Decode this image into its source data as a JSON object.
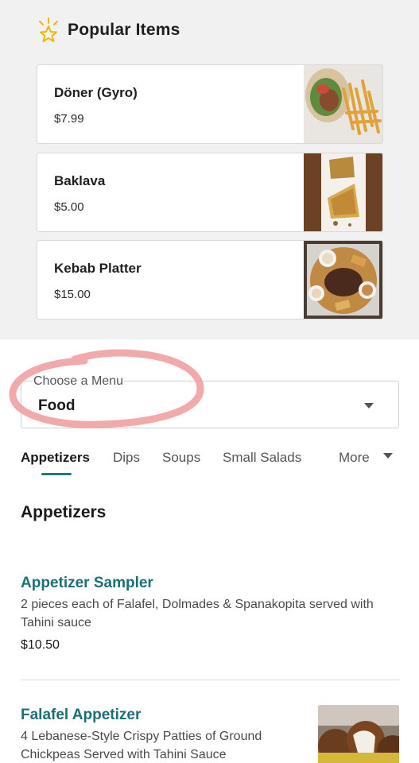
{
  "popular": {
    "title": "Popular Items",
    "items": [
      {
        "name": "Döner (Gyro)",
        "price": "$7.99"
      },
      {
        "name": "Baklava",
        "price": "$5.00"
      },
      {
        "name": "Kebab Platter",
        "price": "$15.00"
      }
    ]
  },
  "menu_select": {
    "label": "Choose a Menu",
    "value": "Food"
  },
  "tabs": {
    "items": [
      "Appetizers",
      "Dips",
      "Soups",
      "Small Salads"
    ],
    "active": "Appetizers",
    "more_label": "More"
  },
  "section": {
    "title": "Appetizers",
    "items": [
      {
        "name": "Appetizer Sampler",
        "description": "2 pieces each of Falafel, Dolmades & Spanakopita served with Tahini sauce",
        "price": "$10.50"
      },
      {
        "name": "Falafel Appetizer",
        "description": "4 Lebanese-Style Crispy Patties of Ground Chickpeas Served with Tahini Sauce"
      }
    ]
  },
  "colors": {
    "accent": "#1c7a83",
    "popular_bg": "#f1f1f1",
    "annotation_circle": "#ef9a9a",
    "star": "#f2b705"
  },
  "icons": {
    "popular": "sparkle-star-icon",
    "dropdown": "caret-down-icon"
  }
}
